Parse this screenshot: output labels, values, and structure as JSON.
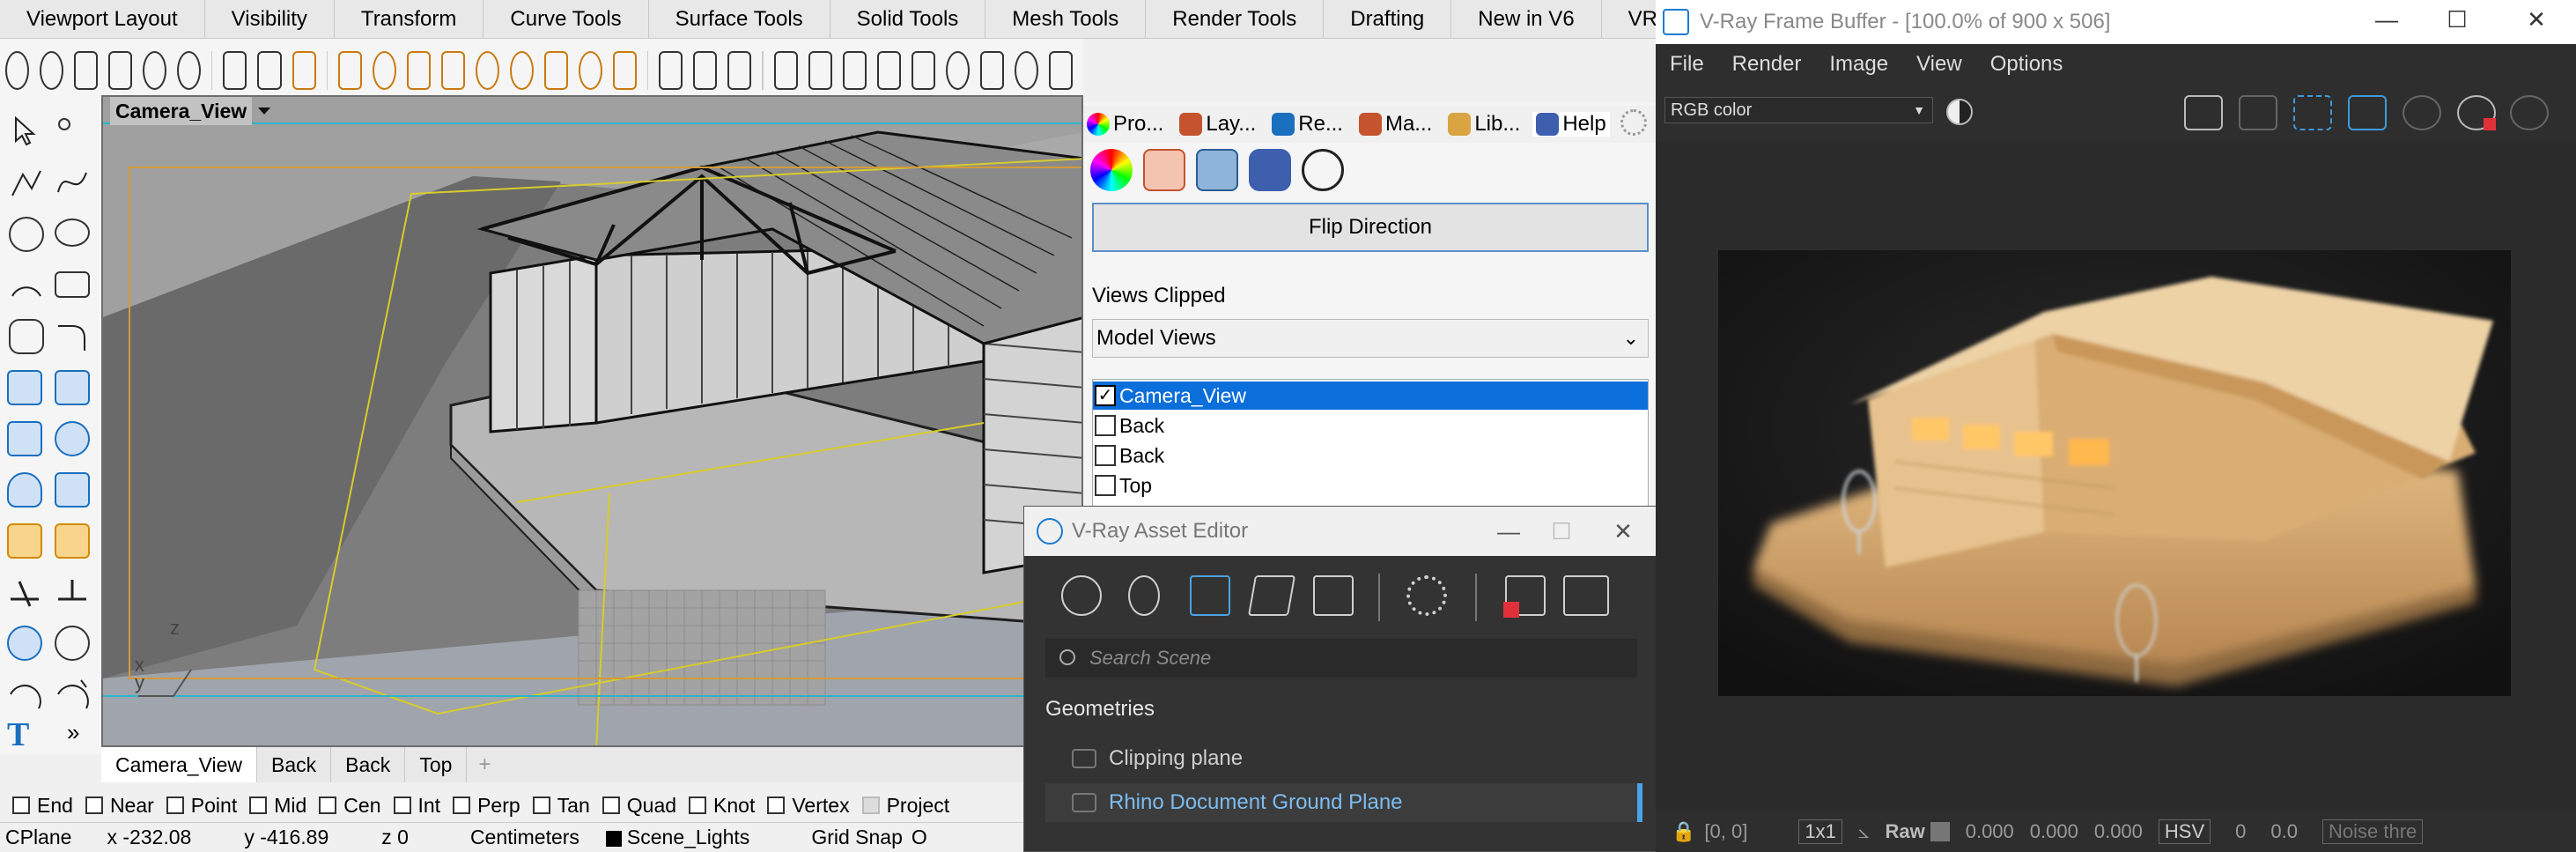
{
  "rhino": {
    "tabs": [
      "Viewport Layout",
      "Visibility",
      "Transform",
      "Curve Tools",
      "Surface Tools",
      "Solid Tools",
      "Mesh Tools",
      "Render Tools",
      "Drafting",
      "New in V6",
      "VRay All"
    ],
    "tabs_more": "»",
    "viewport": {
      "title": "Camera_View",
      "axis_z": "z",
      "axis_x": "x",
      "axis_y": "y"
    },
    "view_tabs": [
      "Camera_View",
      "Back",
      "Back",
      "Top"
    ],
    "view_tab_add": "+",
    "left_more": "»",
    "osnaps": [
      {
        "label": "End",
        "checked": false
      },
      {
        "label": "Near",
        "checked": false
      },
      {
        "label": "Point",
        "checked": false
      },
      {
        "label": "Mid",
        "checked": false
      },
      {
        "label": "Cen",
        "checked": false
      },
      {
        "label": "Int",
        "checked": false
      },
      {
        "label": "Perp",
        "checked": false
      },
      {
        "label": "Tan",
        "checked": false
      },
      {
        "label": "Quad",
        "checked": false
      },
      {
        "label": "Knot",
        "checked": false
      },
      {
        "label": "Vertex",
        "checked": false
      },
      {
        "label": "Project",
        "checked": false,
        "disabled": true
      }
    ],
    "status": {
      "cplane": "CPlane",
      "x": "x -232.08",
      "y": "y -416.89",
      "z": "z 0",
      "units": "Centimeters",
      "layer": "Scene_Lights",
      "grid_snap": "Grid Snap",
      "ortho": "O"
    }
  },
  "panel": {
    "tabs": [
      {
        "label": "Pro...",
        "icon": "color-wheel-icon"
      },
      {
        "label": "Lay...",
        "icon": "layers-icon"
      },
      {
        "label": "Re...",
        "icon": "render-icon"
      },
      {
        "label": "Ma...",
        "icon": "material-brush-icon"
      },
      {
        "label": "Lib...",
        "icon": "folder-icon"
      },
      {
        "label": "Help",
        "icon": "help-icon"
      }
    ],
    "flip_button": "Flip Direction",
    "views_clipped_label": "Views Clipped",
    "views_select": "Model Views",
    "views": [
      {
        "label": "Camera_View",
        "checked": true,
        "selected": true
      },
      {
        "label": "Back",
        "checked": false,
        "selected": false
      },
      {
        "label": "Back",
        "checked": false,
        "selected": false
      },
      {
        "label": "Top",
        "checked": false,
        "selected": false
      }
    ]
  },
  "asset_editor": {
    "title": "V-Ray Asset Editor",
    "search_placeholder": "Search Scene",
    "section": "Geometries",
    "items": [
      {
        "label": "Clipping plane",
        "highlighted": false
      },
      {
        "label": "Rhino Document Ground Plane",
        "highlighted": true
      }
    ]
  },
  "vfb": {
    "title": "V-Ray Frame Buffer - [100.0% of 900 x 506]",
    "menu": [
      "File",
      "Render",
      "Image",
      "View",
      "Options"
    ],
    "channel": "RGB color",
    "status": {
      "coords": "[0, 0]",
      "zoom": "1x1",
      "raw": "Raw",
      "r": "0.000",
      "g": "0.000",
      "b": "0.000",
      "mode": "HSV",
      "h": "0",
      "s": "0.0",
      "noise": "Noise thre"
    }
  },
  "colors": {
    "accent": "#0a6edb",
    "vray_blue": "#1b7bd1",
    "viewport_bg": "#a3a3a3",
    "vfb_bg": "#2b2b2b",
    "render_wood": "#e4b981"
  }
}
